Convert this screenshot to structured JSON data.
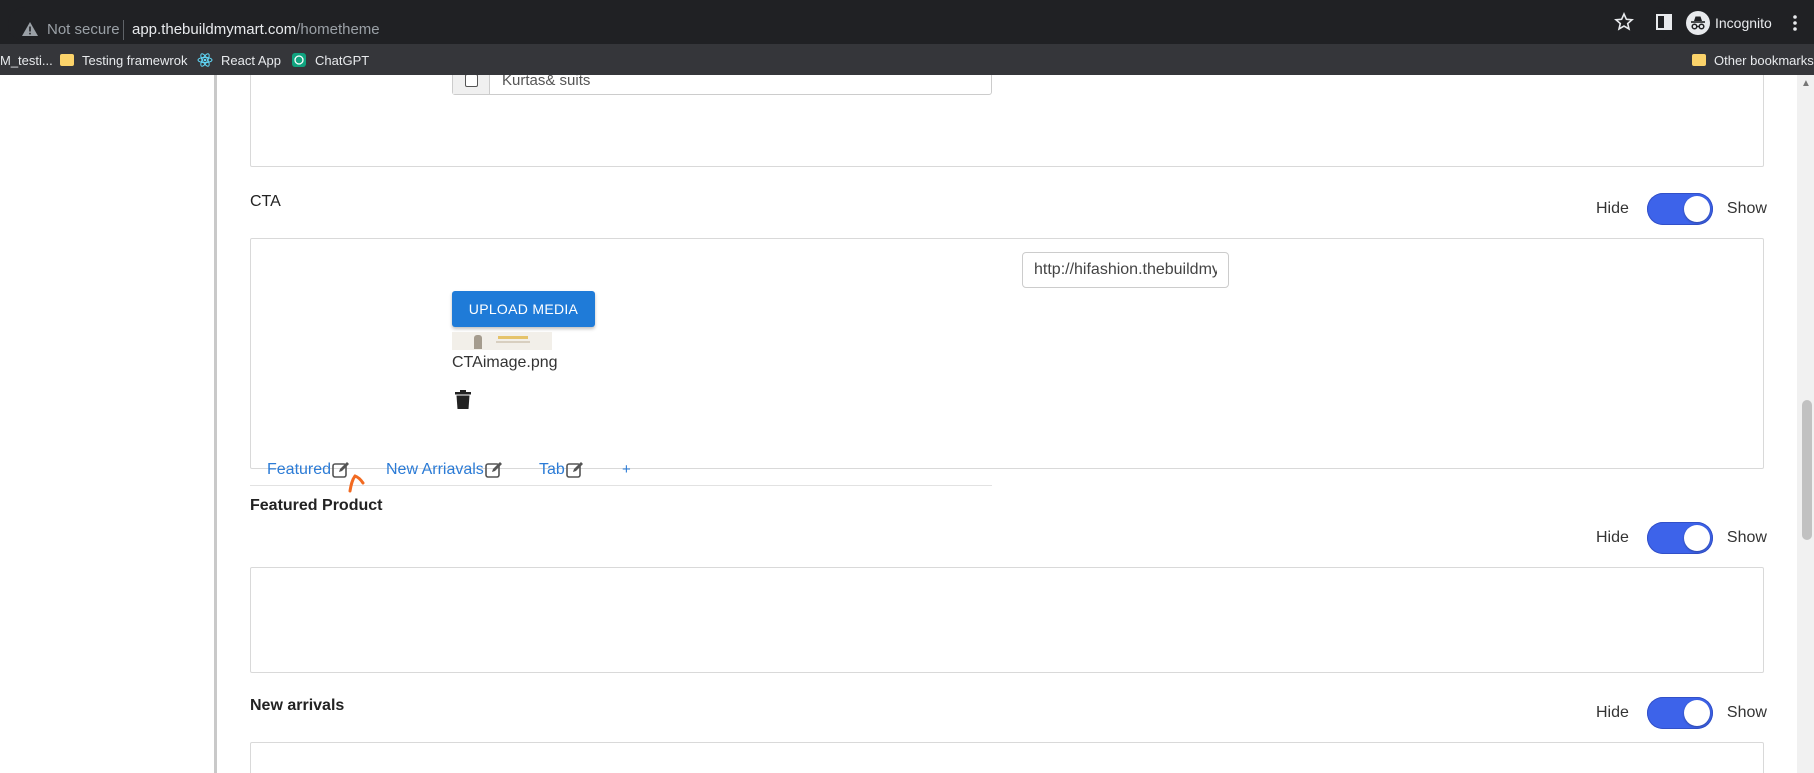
{
  "browser": {
    "security_label": "Not secure",
    "url_host": "app.thebuildmymart.com",
    "url_path": "/hometheme",
    "profile_label": "Incognito",
    "bookmarks": [
      {
        "label": "M_testi...",
        "icon": "folder-icon"
      },
      {
        "label": "Testing framewrok",
        "icon": "folder-icon"
      },
      {
        "label": "React App",
        "icon": "react-icon"
      },
      {
        "label": "ChatGPT",
        "icon": "chatgpt-icon"
      }
    ],
    "other_bookmarks": "Other bookmarks"
  },
  "categories": {
    "item_label": "Kurtas& suits"
  },
  "cta": {
    "title": "CTA",
    "hide_label": "Hide",
    "show_label": "Show",
    "toggle_on": true,
    "upload_label": "UPLOAD MEDIA",
    "file_name": "CTAimage.png",
    "link_value": "http://hifashion.thebuildmymart.com"
  },
  "featured_product": {
    "title": "Featured Product",
    "hide_label": "Hide",
    "show_label": "Show",
    "toggle_on": true,
    "tabs": [
      {
        "label": "Featured"
      },
      {
        "label": "New Arriavals"
      },
      {
        "label": "Tab"
      }
    ],
    "add_tab_label": "+"
  },
  "new_arrivals": {
    "title": "New arrivals",
    "hide_label": "Hide",
    "show_label": "Show",
    "toggle_on": true
  },
  "colors": {
    "accent": "#3d63ea",
    "primary_button": "#1f7bd8",
    "link": "#2b7bd6",
    "annotation": "#f26a21"
  }
}
